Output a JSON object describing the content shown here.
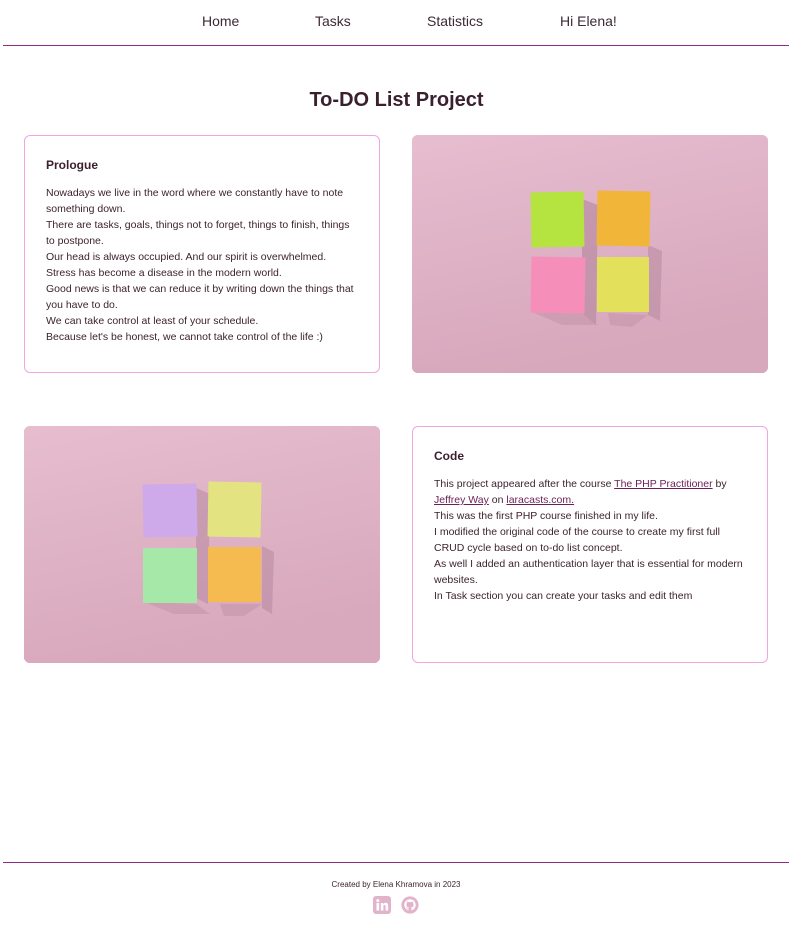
{
  "nav": {
    "home": "Home",
    "tasks": "Tasks",
    "statistics": "Statistics",
    "greeting": "Hi Elena!"
  },
  "page": {
    "title": "To-DO List Project"
  },
  "prologue": {
    "heading": "Prologue",
    "lines": [
      "Nowadays we live in the word where we constantly have to note something down.",
      "There are tasks, goals, things not to forget, things to finish, things to postpone.",
      "Our head is always occupied. And our spirit is overwhelmed.",
      "Stress has become a disease in the modern world.",
      "Good news is that we can reduce it by writing down the things that you have to do.",
      "We can take control at least of your schedule.",
      "Because let's be honest, we cannot take control of the life :)"
    ]
  },
  "code": {
    "heading": "Code",
    "intro_prefix": "This project appeared after the course ",
    "course_link": "The PHP Practitioner",
    "by": " by ",
    "author_link": "Jeffrey Way",
    "on": " on ",
    "site_link": "laracasts.com.",
    "lines": [
      "This was the first PHP course finished in my life.",
      "I modified the original code of the course to create my first full CRUD cycle based on to-do list concept.",
      "As well I added an authentication layer that is essential for modern websites.",
      "In Task section you can create your tasks and edit them"
    ]
  },
  "footer": {
    "credit": "Created by Elena Khramova in 2023"
  },
  "icons": {
    "social_1": "linkedin-icon",
    "social_2": "github-icon"
  },
  "colors": {
    "accent": "#8e2b85",
    "card_border": "#f0a6e0",
    "icon": "#e2b4cc",
    "image_bg": "#e2b8cb",
    "note_green": "#b5e441",
    "note_orange": "#f1b53a",
    "note_pink": "#f58fba",
    "note_yellow": "#e3e05c",
    "note_purple": "#cfaaea",
    "note_yellow_2": "#e3e481",
    "note_mint": "#a6e8a8",
    "note_orange_2": "#f6bb50"
  }
}
